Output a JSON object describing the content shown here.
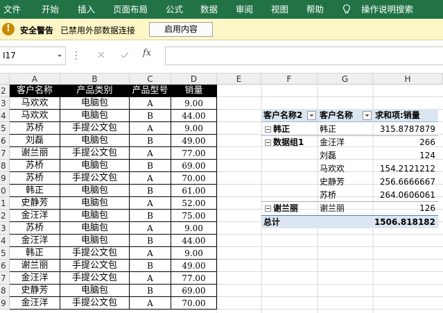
{
  "ribbon": {
    "tabs": [
      "文件",
      "开始",
      "插入",
      "页面布局",
      "公式",
      "数据",
      "审阅",
      "视图",
      "帮助"
    ],
    "tell_me": "操作说明搜索",
    "bg": "#217346"
  },
  "security_bar": {
    "title": "安全警告",
    "message": "已禁用外部数据连接",
    "button": "启用内容"
  },
  "formula_bar": {
    "name_box": "I17",
    "fx": "fx",
    "formula": ""
  },
  "columns": [
    "A",
    "B",
    "C",
    "D",
    "E",
    "F",
    "G",
    "H"
  ],
  "rows": [
    "2",
    "3",
    "4",
    "5",
    "6",
    "7",
    "8",
    "9",
    "0",
    "1",
    "2",
    "3",
    "4",
    "5",
    "6",
    "7",
    "8",
    "9"
  ],
  "table": {
    "headers": [
      "客户名称",
      "产品类别",
      "产品型号",
      "销量"
    ],
    "data": [
      [
        "马欢欢",
        "电脑包",
        "A",
        "9.00"
      ],
      [
        "马欢欢",
        "电脑包",
        "B",
        "44.00"
      ],
      [
        "苏桥",
        "手提公文包",
        "A",
        "9.00"
      ],
      [
        "刘磊",
        "电脑包",
        "B",
        "49.00"
      ],
      [
        "谢兰丽",
        "手提公文包",
        "A",
        "77.00"
      ],
      [
        "苏桥",
        "电脑包",
        "B",
        "69.00"
      ],
      [
        "苏桥",
        "手提公文包",
        "A",
        "70.00"
      ],
      [
        "韩正",
        "电脑包",
        "B",
        "61.00"
      ],
      [
        "史静芳",
        "电脑包",
        "A",
        "52.00"
      ],
      [
        "金汪洋",
        "电脑包",
        "B",
        "75.00"
      ],
      [
        "苏桥",
        "电脑包",
        "A",
        "9.00"
      ],
      [
        "金汪洋",
        "电脑包",
        "B",
        "44.00"
      ],
      [
        "韩正",
        "手提公文包",
        "A",
        "9.00"
      ],
      [
        "谢兰丽",
        "手提公文包",
        "B",
        "49.00"
      ],
      [
        "金汪洋",
        "手提公文包",
        "A",
        "77.00"
      ],
      [
        "史静芳",
        "电脑包",
        "B",
        "69.00"
      ],
      [
        "金汪洋",
        "手提公文包",
        "A",
        "70.00"
      ]
    ]
  },
  "pivot": {
    "headers": [
      "客户名称2",
      "客户名称",
      "求和项:销量"
    ],
    "groups": [
      {
        "label": "韩正",
        "items": [
          {
            "name": "韩正",
            "value": "315.8787879"
          }
        ]
      },
      {
        "label": "数据组1",
        "items": [
          {
            "name": "金汪洋",
            "value": "266"
          },
          {
            "name": "刘磊",
            "value": "124"
          },
          {
            "name": "马欢欢",
            "value": "154.2121212"
          },
          {
            "name": "史静芳",
            "value": "256.6666667"
          },
          {
            "name": "苏桥",
            "value": "264.0606061"
          }
        ]
      },
      {
        "label": "谢兰丽",
        "items": [
          {
            "name": "谢兰丽",
            "value": "126"
          }
        ]
      }
    ],
    "total_label": "总计",
    "total_value": "1506.818182",
    "accent": "#dce6f1"
  }
}
